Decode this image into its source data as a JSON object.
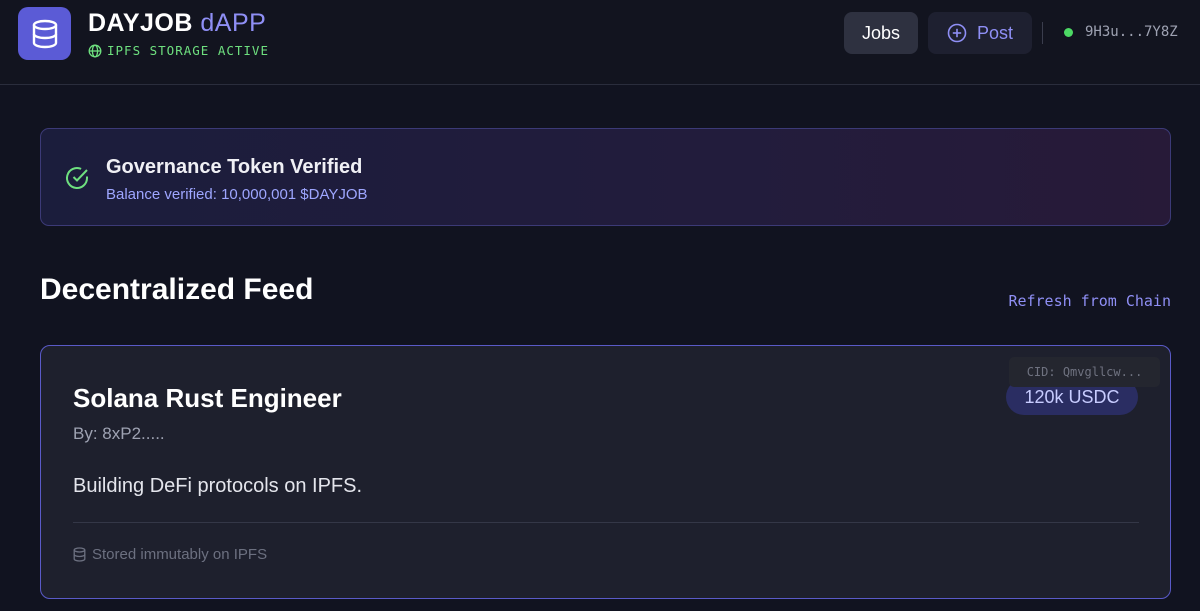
{
  "header": {
    "app_name": "DAYJOB",
    "app_suffix": "dAPP",
    "storage_status": "IPFS STORAGE ACTIVE",
    "nav": {
      "jobs_label": "Jobs",
      "post_label": "Post"
    },
    "wallet_address": "9H3u...7Y8Z",
    "icons": {
      "logo": "database-icon",
      "storage": "globe-icon",
      "post": "plus-circle-icon",
      "wallet_status": "status-dot"
    }
  },
  "banner": {
    "title": "Governance Token Verified",
    "subtitle": "Balance verified: 10,000,001 $DAYJOB",
    "icon": "check-circle-icon"
  },
  "feed": {
    "title": "Decentralized Feed",
    "refresh_label": "Refresh from Chain",
    "jobs": [
      {
        "title": "Solana Rust Engineer",
        "author": "By: 8xP2.....",
        "salary": "120k USDC",
        "cid": "CID: Qmvgllcw...",
        "description": "Building DeFi protocols on IPFS.",
        "storage_note": "Stored immutably on IPFS",
        "storage_icon": "database-icon"
      }
    ]
  },
  "colors": {
    "background": "#111320",
    "accent": "#5b5bd6",
    "accent_text": "#8f8ff5",
    "success": "#6ee07f",
    "card_border": "#5a5ac8"
  }
}
